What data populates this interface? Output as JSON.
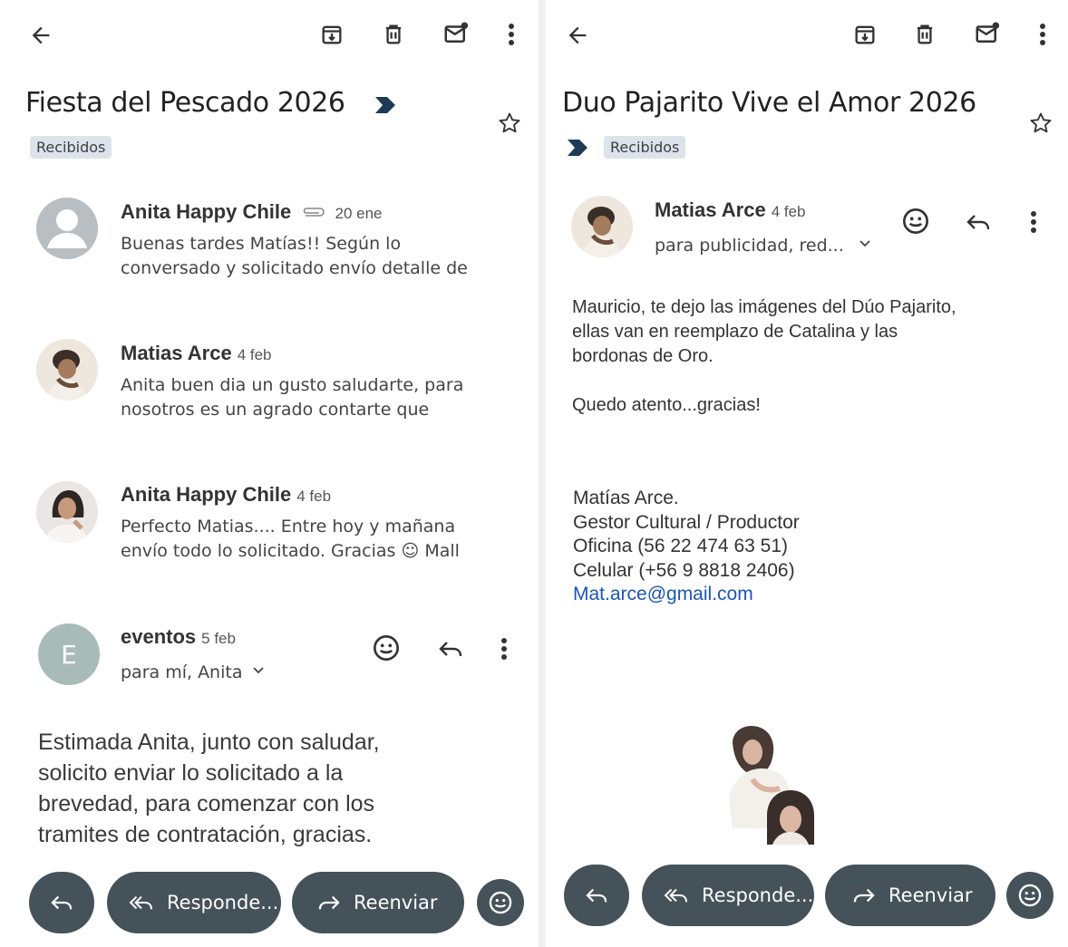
{
  "left": {
    "subject": "Fiesta del Pescado 2026",
    "label": "Recibidos",
    "messages": [
      {
        "sender": "Anita Happy Chile",
        "date": "20 ene",
        "line1": "Buenas tardes Matías!! Según lo",
        "line2": "conversado y solicitado envío detalle de"
      },
      {
        "sender": "Matias Arce",
        "date": "4 feb",
        "line1": "Anita buen dia un gusto saludarte, para",
        "line2": "nosotros es un agrado contarte que"
      },
      {
        "sender": "Anita Happy Chile",
        "date": "4 feb",
        "line1": "Perfecto Matias.... Entre hoy y mañana",
        "line2": "envío todo lo solicitado. Gracias ☺ Mall"
      }
    ],
    "open": {
      "sender": "eventos",
      "date": "5 feb",
      "avatar_letter": "E",
      "recipients": "para mí, Anita",
      "body": [
        "Estimada Anita, junto con saludar,",
        "solicito  enviar lo solicitado a la",
        "brevedad, para comenzar con los",
        "tramites de contratación, gracias."
      ]
    },
    "actions": {
      "reply_all": "Responde...",
      "forward": "Reenviar"
    }
  },
  "right": {
    "subject": "Duo Pajarito Vive el Amor 2026",
    "label": "Recibidos",
    "open": {
      "sender": "Matias Arce",
      "date": "4 feb",
      "recipients": "para publicidad, red...",
      "body": [
        "Mauricio, te dejo las imágenes del Dúo Pajarito,",
        "ellas van en reemplazo de Catalina y las",
        "bordonas de Oro.",
        "",
        "Quedo atento...gracias!"
      ],
      "signature": {
        "name": "Matías Arce.",
        "role": "Gestor Cultural / Productor",
        "office": "Oficina (56 22 474 63 51)",
        "mobile": "Celular (+56 9 8818 2406)",
        "email": "Mat.arce@gmail.com"
      }
    },
    "actions": {
      "reply_all": "Responde...",
      "forward": "Reenviar"
    }
  },
  "icons": [
    "back-arrow-icon",
    "archive-icon",
    "trash-icon",
    "mark-unread-icon",
    "more-vert-icon",
    "star-icon",
    "importance-marker-icon",
    "attachment-icon",
    "emoji-icon",
    "reply-icon",
    "reply-all-icon",
    "forward-icon",
    "chevron-down-icon"
  ],
  "colors": {
    "bottom_button": "#45525a",
    "label_chip": "#dde3ea",
    "link": "#1a55b8",
    "importance_marker": "#1d3b56"
  }
}
